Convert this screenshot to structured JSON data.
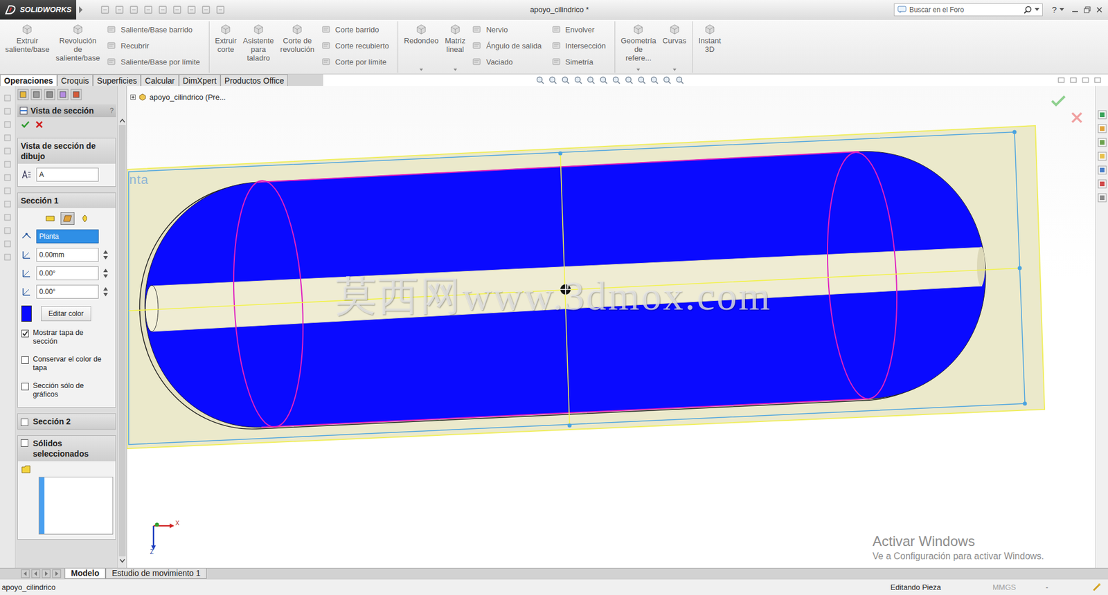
{
  "window": {
    "logo": "SOLIDWORKS",
    "title": "apoyo_cilindrico *",
    "search_placeholder": "Buscar en el Foro",
    "help": "?"
  },
  "ribbon": {
    "groups": [
      [
        {
          "kind": "large",
          "label": "Extruir saliente/base",
          "menu": false
        },
        {
          "kind": "large",
          "label": "Revolución de saliente/base",
          "menu": false
        },
        {
          "kind": "stack",
          "labels": [
            "Saliente/Base barrido",
            "Recubrir",
            "Saliente/Base por límite"
          ]
        }
      ],
      [
        {
          "kind": "large",
          "label": "Extruir corte",
          "menu": false
        },
        {
          "kind": "large",
          "label": "Asistente para taladro",
          "menu": false
        },
        {
          "kind": "large",
          "label": "Corte de revolución",
          "menu": false
        },
        {
          "kind": "stack",
          "labels": [
            "Corte barrido",
            "Corte recubierto",
            "Corte por límite"
          ]
        }
      ],
      [
        {
          "kind": "large",
          "label": "Redondeo",
          "menu": true
        },
        {
          "kind": "large",
          "label": "Matriz lineal",
          "menu": true
        },
        {
          "kind": "stack",
          "labels": [
            "Nervio",
            "Ángulo de salida",
            "Vaciado"
          ]
        },
        {
          "kind": "stack",
          "labels": [
            "Envolver",
            "Intersección",
            "Simetría"
          ]
        }
      ],
      [
        {
          "kind": "large",
          "label": "Geometría de refere...",
          "menu": true
        },
        {
          "kind": "large",
          "label": "Curvas",
          "menu": true
        }
      ],
      [
        {
          "kind": "large",
          "label": "Instant 3D",
          "menu": false
        }
      ]
    ]
  },
  "command_tabs": [
    {
      "label": "Operaciones",
      "selected": true
    },
    {
      "label": "Croquis",
      "selected": false
    },
    {
      "label": "Superficies",
      "selected": false
    },
    {
      "label": "Calcular",
      "selected": false
    },
    {
      "label": "DimXpert",
      "selected": false
    },
    {
      "label": "Productos Office",
      "selected": false
    }
  ],
  "feature_tree": {
    "label": "apoyo_cilindrico  (Pre..."
  },
  "property_manager": {
    "title": "Vista de sección",
    "help": "?",
    "drawing_section": {
      "title": "Vista de sección de dibujo",
      "name": "A"
    },
    "section1": {
      "title": "Sección 1",
      "plane": "Planta",
      "plane_selected": true,
      "mode_buttons": [
        {
          "selected": false
        },
        {
          "selected": true
        },
        {
          "selected": false
        }
      ],
      "fields": [
        {
          "value": "0.00mm"
        },
        {
          "value": "0.00°"
        },
        {
          "value": "0.00°"
        }
      ],
      "cap_color": "#0a0aff",
      "edit_color": "Editar color"
    },
    "options": [
      {
        "label": "Mostrar tapa de sección",
        "checked": true
      },
      {
        "label": "Conservar el color de tapa",
        "checked": false
      },
      {
        "label": "Sección sólo de gráficos",
        "checked": false
      }
    ],
    "section2": {
      "label": "Sección 2",
      "checked": false
    },
    "solids": {
      "label": "Sólidos seleccionados",
      "checked": false
    }
  },
  "viewport": {
    "plane_label": "nta",
    "watermark": "莫西网www.3dmox.com",
    "axes": [
      "X",
      "Z"
    ]
  },
  "activation": {
    "title": "Activar Windows",
    "message": "Ve a Configuración para activar Windows."
  },
  "bottom_tabs": [
    {
      "label": "Modelo",
      "selected": true
    },
    {
      "label": "Estudio de movimiento 1",
      "selected": false
    }
  ],
  "status_bar": {
    "file": "apoyo_cilindrico",
    "mode": "Editando Pieza",
    "units": "MMGS",
    "extra": "-"
  }
}
